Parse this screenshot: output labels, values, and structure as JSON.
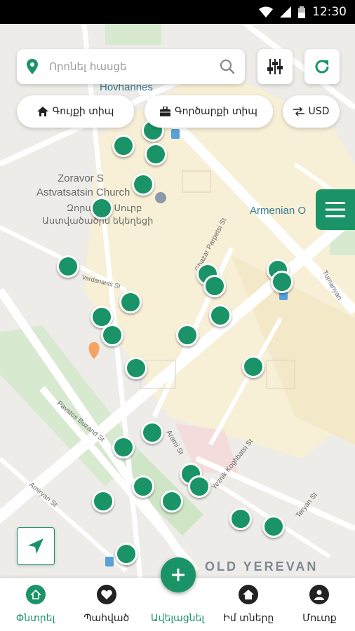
{
  "status_bar": {
    "time": "12:30"
  },
  "search": {
    "placeholder": "Որոնել հասցե",
    "value": ""
  },
  "filters": {
    "home_type": "Գույքի տիպ",
    "business_type": "Գործարքի տիպ",
    "currency": "USD"
  },
  "map": {
    "labels": {
      "hovhannes": "Hovhannes",
      "zoravor_1": "Zoravor S",
      "zoravor_2": "Astvatsatsin Church",
      "zoravor_arm_1": "Զորավոր Սուրբ",
      "zoravor_arm_2": "Աստվածածին եկեղեցի",
      "armenian_o": "Armenian O",
      "old_yerevan": "OLD YEREVAN",
      "ghazar_st": "Ghazar Parpetsi St",
      "tumanyan": "Tumanyan",
      "vardanants": "Vardanants St",
      "pavstos": "Pavstos Buzand St",
      "arami": "Arami St",
      "amiryan": "Amiryan St",
      "koghbatsi": "Yeznik Koghbatsi St",
      "teryan": "Teryan St"
    },
    "marker_count": 30
  },
  "bottom_nav": {
    "search": "Փնտրել",
    "saved": "Պահված",
    "add": "Ավելացնել",
    "my_homes": "Իմ տները",
    "login": "Մուտք"
  },
  "colors": {
    "accent": "#1a9466",
    "nav_inactive": "#222222",
    "map_bg": "#eeece8"
  },
  "icons": [
    "location-pin-icon",
    "search-icon",
    "sliders-icon",
    "refresh-icon",
    "home-icon",
    "briefcase-icon",
    "swap-icon",
    "menu-icon",
    "navigate-arrow-icon",
    "plus-icon",
    "heart-icon",
    "user-icon"
  ]
}
